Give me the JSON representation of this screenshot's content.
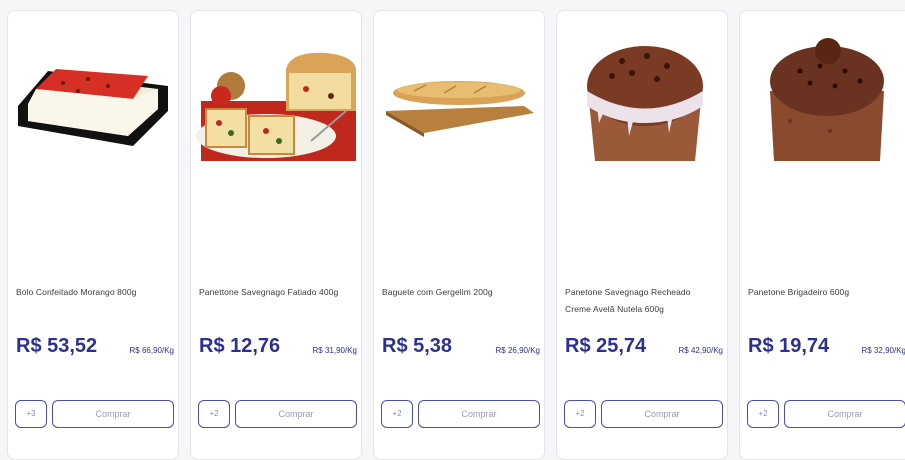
{
  "products": [
    {
      "name": "Bolo Confeitado Morango 800g",
      "price": "R$ 53,52",
      "price_per_kg": "R$ 66,90/Kg",
      "qty_label": "+3",
      "buy_label": "Comprar",
      "image": "strawberry-cake-image"
    },
    {
      "name": "Panettone Savegnago Fatiado 400g",
      "price": "R$ 12,76",
      "price_per_kg": "R$ 31,90/Kg",
      "qty_label": "+2",
      "buy_label": "Comprar",
      "image": "sliced-panettone-image"
    },
    {
      "name": "Baguete com Gergelim 200g",
      "price": "R$ 5,38",
      "price_per_kg": "R$ 26,90/Kg",
      "qty_label": "+2",
      "buy_label": "Comprar",
      "image": "baguette-image"
    },
    {
      "name": "Panetone Savegnago Recheado Creme Avelã Nutela 600g",
      "price": "R$ 25,74",
      "price_per_kg": "R$ 42,90/Kg",
      "qty_label": "+2",
      "buy_label": "Comprar",
      "image": "nutella-panettone-image"
    },
    {
      "name": "Panetone Brigadeiro 600g",
      "price": "R$ 19,74",
      "price_per_kg": "R$ 32,90/Kg",
      "qty_label": "+2",
      "buy_label": "Comprar",
      "image": "brigadeiro-panettone-image"
    }
  ],
  "colors": {
    "accent": "#2c3190",
    "border": "#4a4fa8"
  }
}
